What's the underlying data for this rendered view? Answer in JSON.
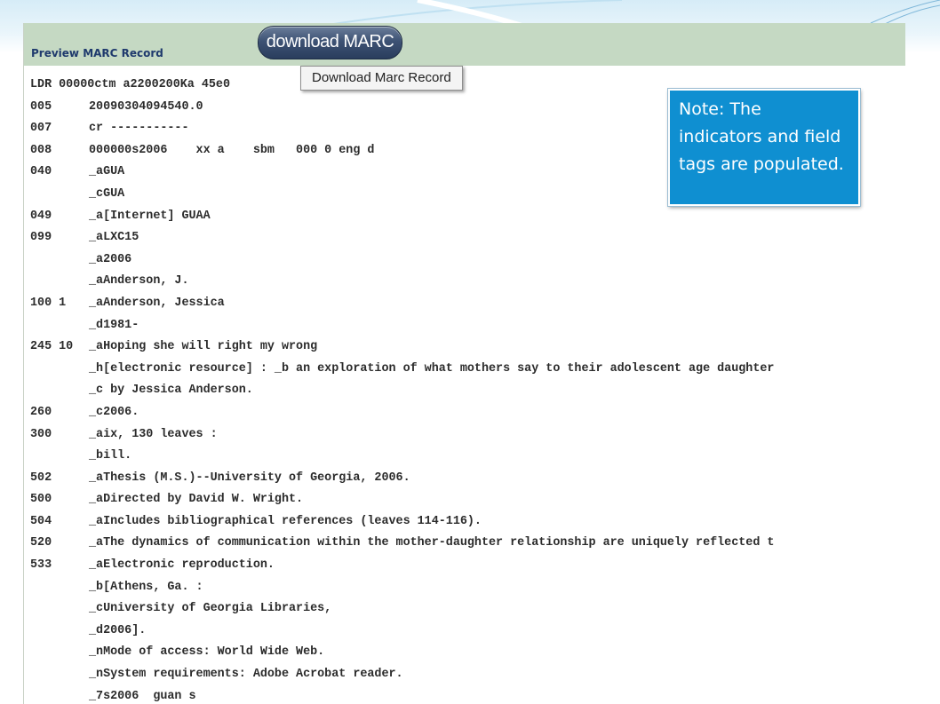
{
  "header": {
    "title": "Preview MARC Record",
    "download_button": "download MARC",
    "tooltip": "Download Marc Record"
  },
  "note": "Note: The indicators and field tags are populated.",
  "record": {
    "leader": "LDR 00000ctm a2200200Ka 45e0",
    "lines": [
      {
        "tag": "005",
        "value": "20090304094540.0"
      },
      {
        "tag": "007",
        "value": "cr -----------"
      },
      {
        "tag": "008",
        "value": "000000s2006    xx a    sbm   000 0 eng d"
      },
      {
        "tag": "040",
        "value": "_aGUA"
      },
      {
        "tag": "",
        "value": "_cGUA"
      },
      {
        "tag": "049",
        "value": "_a[Internet] GUAA"
      },
      {
        "tag": "099",
        "value": "_aLXC15"
      },
      {
        "tag": "",
        "value": "_a2006"
      },
      {
        "tag": "",
        "value": "_aAnderson, J."
      },
      {
        "tag": "100 1",
        "value": "_aAnderson, Jessica"
      },
      {
        "tag": "",
        "value": "_d1981-"
      },
      {
        "tag": "245 10",
        "value": "_aHoping she will right my wrong"
      },
      {
        "tag": "",
        "value": "_h[electronic resource] : _b an exploration of what mothers say to their adolescent age daughter"
      },
      {
        "tag": "",
        "value": "_c by Jessica Anderson."
      },
      {
        "tag": "260",
        "value": "_c2006."
      },
      {
        "tag": "300",
        "value": "_aix, 130 leaves :"
      },
      {
        "tag": "",
        "value": "_bill."
      },
      {
        "tag": "502",
        "value": "_aThesis (M.S.)--University of Georgia, 2006."
      },
      {
        "tag": "500",
        "value": "_aDirected by David W. Wright."
      },
      {
        "tag": "504",
        "value": "_aIncludes bibliographical references (leaves 114-116)."
      },
      {
        "tag": "520",
        "value": "_aThe dynamics of communication within the mother-daughter relationship are uniquely reflected t"
      },
      {
        "tag": "533",
        "value": "_aElectronic reproduction."
      },
      {
        "tag": "",
        "value": "_b[Athens, Ga. :"
      },
      {
        "tag": "",
        "value": "_cUniversity of Georgia Libraries,"
      },
      {
        "tag": "",
        "value": "_d2006]."
      },
      {
        "tag": "",
        "value": "_nMode of access: World Wide Web."
      },
      {
        "tag": "",
        "value": "_nSystem requirements: Adobe Acrobat reader."
      },
      {
        "tag": "",
        "value": "_7s2006  guan s"
      }
    ]
  }
}
